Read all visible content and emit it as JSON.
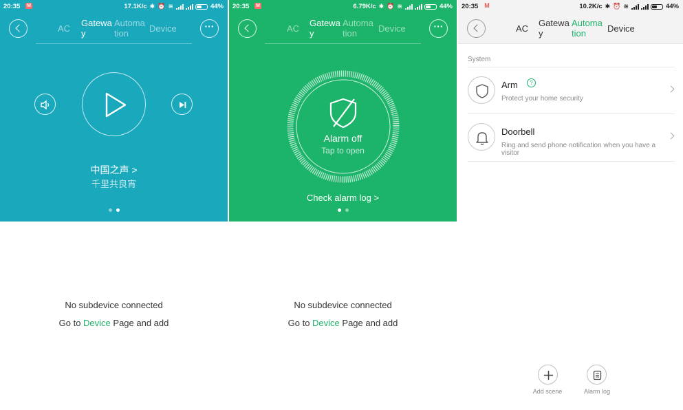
{
  "panels": [
    {
      "status": {
        "time": "20:35",
        "network": "17.1K/c",
        "battery": "44%"
      },
      "tabs": [
        "AC",
        "Gatewa\ny",
        "Automa\ntion",
        "Device"
      ],
      "player": {
        "station": "中国之声 >",
        "program": "千里共良宵"
      },
      "empty": {
        "line1": "No subdevice connected",
        "line2_prefix": "Go to ",
        "line2_link": "Device",
        "line2_suffix": " Page and add"
      }
    },
    {
      "status": {
        "time": "20:35",
        "network": "6.79K/c",
        "battery": "44%"
      },
      "tabs": [
        "AC",
        "Gatewa\ny",
        "Automa\ntion",
        "Device"
      ],
      "alarm": {
        "state": "Alarm off",
        "hint": "Tap to open",
        "log_link": "Check alarm log  >"
      },
      "empty": {
        "line1": "No subdevice connected",
        "line2_prefix": "Go to ",
        "line2_link": "Device",
        "line2_suffix": " Page and add"
      }
    },
    {
      "status": {
        "time": "20:35",
        "network": "10.2K/c",
        "battery": "44%"
      },
      "tabs": [
        "AC",
        "Gatewa\ny",
        "Automa\ntion",
        "Device"
      ],
      "section": "System",
      "items": [
        {
          "title": "Arm",
          "subtitle": "Protect your home security",
          "badge": "?"
        },
        {
          "title": "Doorbell",
          "subtitle": "Ring and send phone notification when you have a visitor"
        }
      ],
      "actions": {
        "add_scene": "Add scene",
        "alarm_log": "Alarm log"
      }
    }
  ],
  "colors": {
    "teal": "#1aa8bd",
    "green": "#1cb46a"
  },
  "icons": [
    "back-icon",
    "more-icon",
    "volume-icon",
    "play-icon",
    "next-track-icon",
    "shield-off-icon",
    "shield-icon",
    "bell-icon",
    "plus-icon",
    "list-icon",
    "chevron-right-icon",
    "help-icon"
  ]
}
